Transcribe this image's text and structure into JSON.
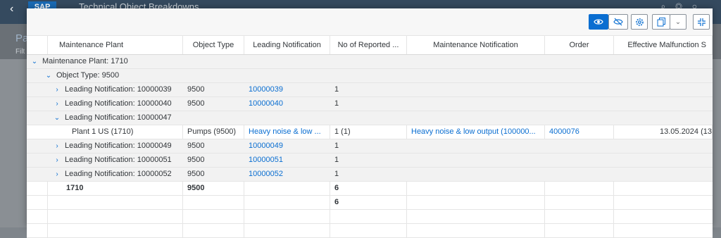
{
  "background": {
    "shell_logo": "SAP",
    "shell_title": "Technical Object Breakdowns",
    "page_title_fragment": "Pa",
    "filter_fragment": "Filt"
  },
  "toolbar": {
    "buttons": [
      "eye-icon",
      "eye-slash-icon",
      "gear-icon",
      "copy-icon",
      "chevron-down-icon",
      "exit-fullscreen-icon"
    ]
  },
  "table": {
    "columns": [
      "Maintenance Plant",
      "Object Type",
      "Leading Notification",
      "No of Reported ...",
      "Maintenance Notification",
      "Order",
      "Effective Malfunction S"
    ],
    "rows": [
      {
        "kind": "group",
        "level": 0,
        "expanded": true,
        "label": "Maintenance Plant: 1710"
      },
      {
        "kind": "group",
        "level": 1,
        "expanded": true,
        "label": "Object Type: 9500"
      },
      {
        "kind": "group",
        "level": 2,
        "expanded": false,
        "label": "Leading Notification: 10000039",
        "object_type": "9500",
        "leading": "10000039",
        "reported": "1"
      },
      {
        "kind": "group",
        "level": 2,
        "expanded": false,
        "label": "Leading Notification: 10000040",
        "object_type": "9500",
        "leading": "10000040",
        "reported": "1"
      },
      {
        "kind": "group",
        "level": 2,
        "expanded": true,
        "label": "Leading Notification: 10000047"
      },
      {
        "kind": "data",
        "plant": "Plant 1 US (1710)",
        "object_type": "Pumps (9500)",
        "leading": "Heavy noise & low ...",
        "reported": "1 (1)",
        "notification": "Heavy noise & low output (100000...",
        "order": "4000076",
        "malfunction": "13.05.2024 (13"
      },
      {
        "kind": "group",
        "level": 2,
        "expanded": false,
        "label": "Leading Notification: 10000049",
        "object_type": "9500",
        "leading": "10000049",
        "reported": "1"
      },
      {
        "kind": "group",
        "level": 2,
        "expanded": false,
        "label": "Leading Notification: 10000051",
        "object_type": "9500",
        "leading": "10000051",
        "reported": "1"
      },
      {
        "kind": "group",
        "level": 2,
        "expanded": false,
        "label": "Leading Notification: 10000052",
        "object_type": "9500",
        "leading": "10000052",
        "reported": "1"
      },
      {
        "kind": "subtotal",
        "plant": "1710",
        "object_type": "9500",
        "reported": "6"
      },
      {
        "kind": "total",
        "reported": "6"
      }
    ]
  },
  "colors": {
    "accent": "#0a6ed1",
    "group_bg": "#f2f2f2",
    "shell": "#354a5f"
  }
}
